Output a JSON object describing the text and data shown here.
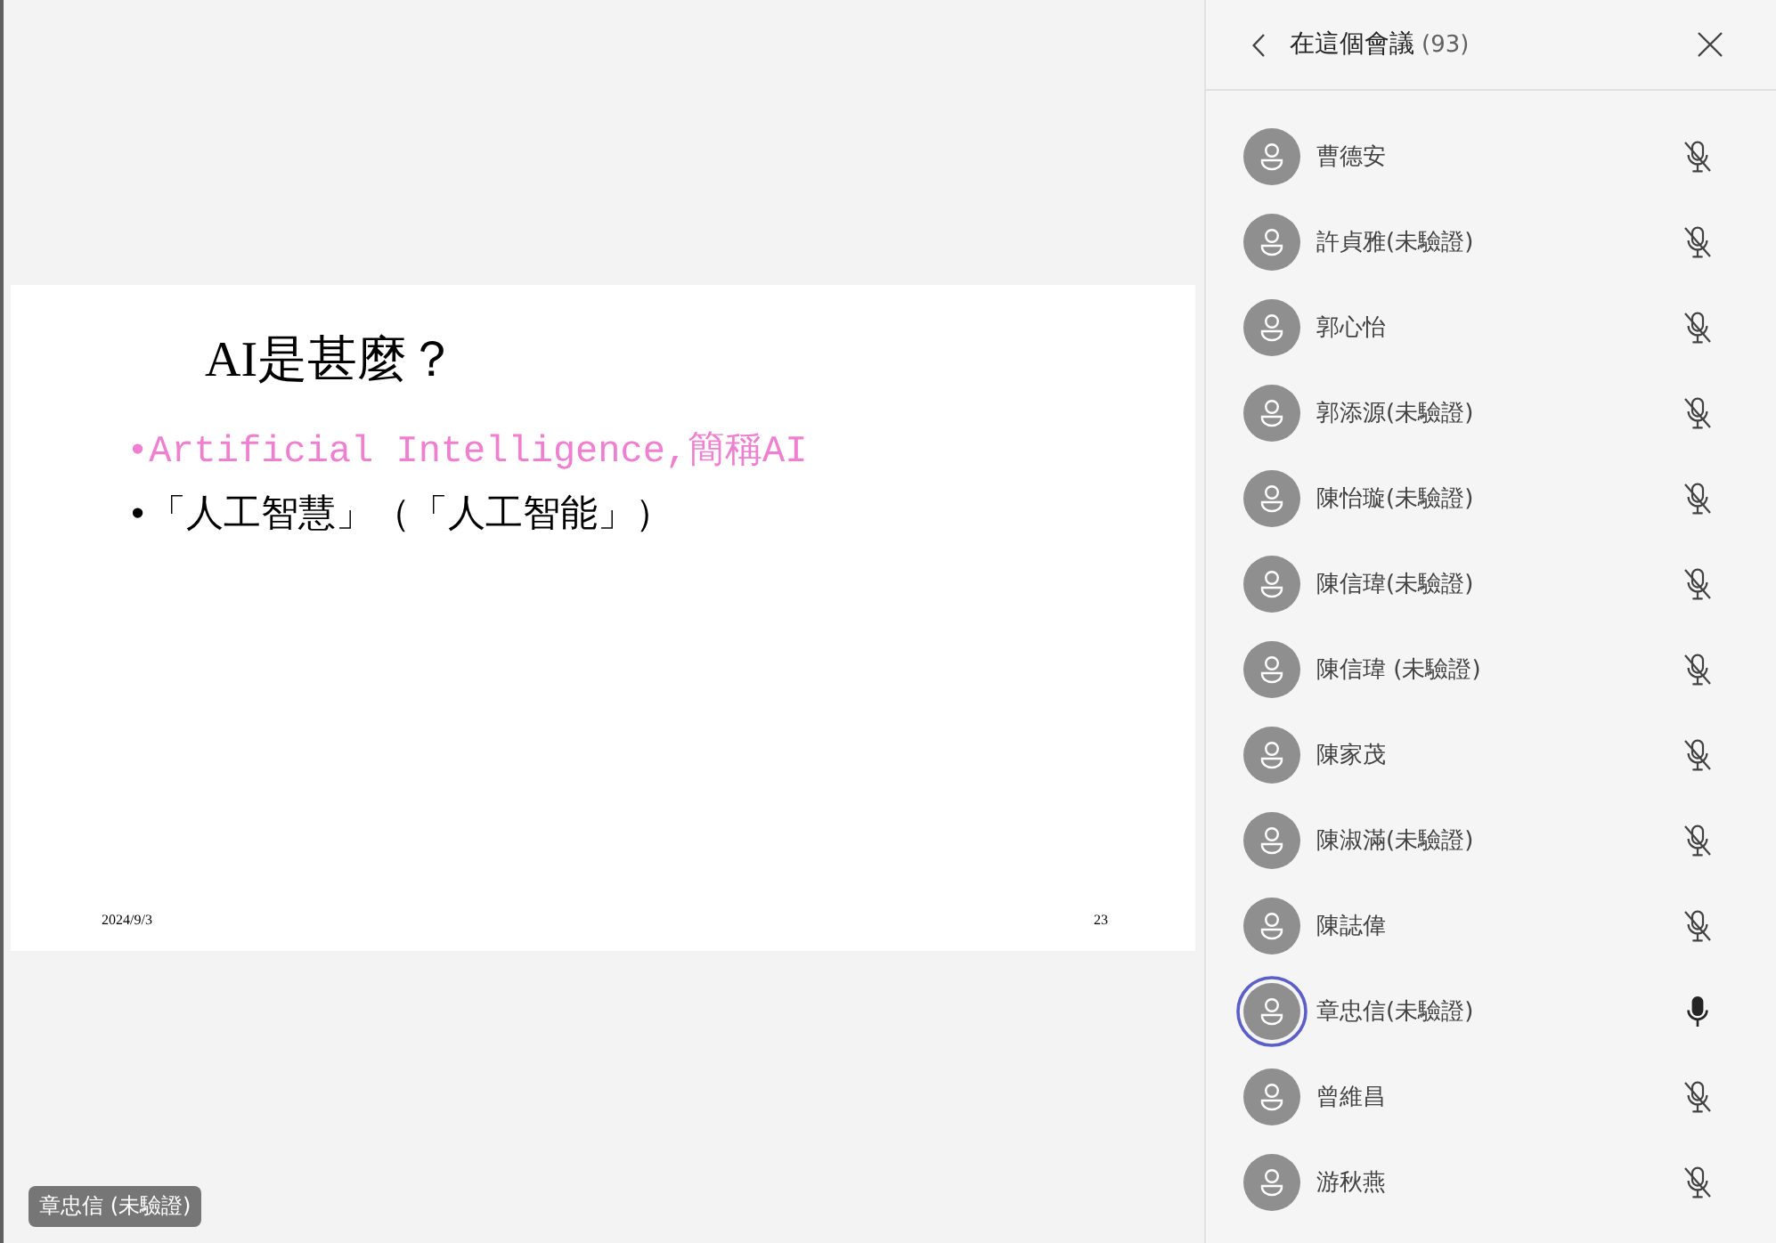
{
  "stage": {
    "slide": {
      "title": "AI是甚麼？",
      "bullets": [
        {
          "text": "•Artificial Intelligence,簡稱AI",
          "color": "#ef7fcf"
        },
        {
          "text": "•「人工智慧」（「人工智能」）",
          "color": "#000000"
        }
      ],
      "date": "2024/9/3",
      "page": "23"
    },
    "name_tag": "章忠信 (未驗證)"
  },
  "panel": {
    "title": "在這個會議",
    "count": "(93)",
    "participants": [
      {
        "name": "曹德安",
        "muted": true,
        "speaking": false
      },
      {
        "name": "許貞雅(未驗證)",
        "muted": true,
        "speaking": false
      },
      {
        "name": "郭心怡",
        "muted": true,
        "speaking": false
      },
      {
        "name": "郭添源(未驗證)",
        "muted": true,
        "speaking": false
      },
      {
        "name": "陳怡璇(未驗證)",
        "muted": true,
        "speaking": false
      },
      {
        "name": "陳信瑋(未驗證)",
        "muted": true,
        "speaking": false
      },
      {
        "name": "陳信瑋 (未驗證)",
        "muted": true,
        "speaking": false
      },
      {
        "name": "陳家茂",
        "muted": true,
        "speaking": false
      },
      {
        "name": "陳淑滿(未驗證)",
        "muted": true,
        "speaking": false
      },
      {
        "name": "陳誌偉",
        "muted": true,
        "speaking": false
      },
      {
        "name": "章忠信(未驗證)",
        "muted": false,
        "speaking": true
      },
      {
        "name": "曾維昌",
        "muted": true,
        "speaking": false
      },
      {
        "name": "游秋燕",
        "muted": true,
        "speaking": false
      }
    ]
  }
}
